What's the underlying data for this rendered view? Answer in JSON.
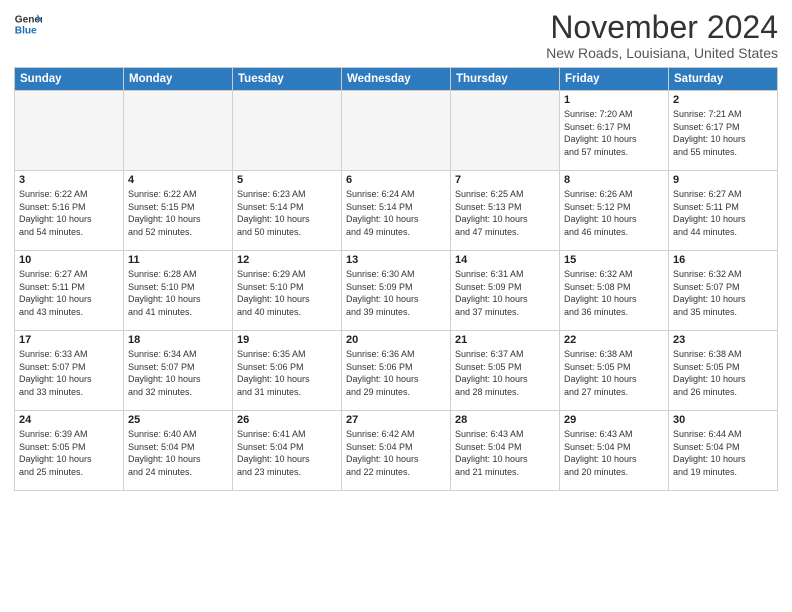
{
  "header": {
    "logo_general": "General",
    "logo_blue": "Blue",
    "month_title": "November 2024",
    "location": "New Roads, Louisiana, United States"
  },
  "weekdays": [
    "Sunday",
    "Monday",
    "Tuesday",
    "Wednesday",
    "Thursday",
    "Friday",
    "Saturday"
  ],
  "weeks": [
    [
      {
        "day": "",
        "info": ""
      },
      {
        "day": "",
        "info": ""
      },
      {
        "day": "",
        "info": ""
      },
      {
        "day": "",
        "info": ""
      },
      {
        "day": "",
        "info": ""
      },
      {
        "day": "1",
        "info": "Sunrise: 7:20 AM\nSunset: 6:17 PM\nDaylight: 10 hours\nand 57 minutes."
      },
      {
        "day": "2",
        "info": "Sunrise: 7:21 AM\nSunset: 6:17 PM\nDaylight: 10 hours\nand 55 minutes."
      }
    ],
    [
      {
        "day": "3",
        "info": "Sunrise: 6:22 AM\nSunset: 5:16 PM\nDaylight: 10 hours\nand 54 minutes."
      },
      {
        "day": "4",
        "info": "Sunrise: 6:22 AM\nSunset: 5:15 PM\nDaylight: 10 hours\nand 52 minutes."
      },
      {
        "day": "5",
        "info": "Sunrise: 6:23 AM\nSunset: 5:14 PM\nDaylight: 10 hours\nand 50 minutes."
      },
      {
        "day": "6",
        "info": "Sunrise: 6:24 AM\nSunset: 5:14 PM\nDaylight: 10 hours\nand 49 minutes."
      },
      {
        "day": "7",
        "info": "Sunrise: 6:25 AM\nSunset: 5:13 PM\nDaylight: 10 hours\nand 47 minutes."
      },
      {
        "day": "8",
        "info": "Sunrise: 6:26 AM\nSunset: 5:12 PM\nDaylight: 10 hours\nand 46 minutes."
      },
      {
        "day": "9",
        "info": "Sunrise: 6:27 AM\nSunset: 5:11 PM\nDaylight: 10 hours\nand 44 minutes."
      }
    ],
    [
      {
        "day": "10",
        "info": "Sunrise: 6:27 AM\nSunset: 5:11 PM\nDaylight: 10 hours\nand 43 minutes."
      },
      {
        "day": "11",
        "info": "Sunrise: 6:28 AM\nSunset: 5:10 PM\nDaylight: 10 hours\nand 41 minutes."
      },
      {
        "day": "12",
        "info": "Sunrise: 6:29 AM\nSunset: 5:10 PM\nDaylight: 10 hours\nand 40 minutes."
      },
      {
        "day": "13",
        "info": "Sunrise: 6:30 AM\nSunset: 5:09 PM\nDaylight: 10 hours\nand 39 minutes."
      },
      {
        "day": "14",
        "info": "Sunrise: 6:31 AM\nSunset: 5:09 PM\nDaylight: 10 hours\nand 37 minutes."
      },
      {
        "day": "15",
        "info": "Sunrise: 6:32 AM\nSunset: 5:08 PM\nDaylight: 10 hours\nand 36 minutes."
      },
      {
        "day": "16",
        "info": "Sunrise: 6:32 AM\nSunset: 5:07 PM\nDaylight: 10 hours\nand 35 minutes."
      }
    ],
    [
      {
        "day": "17",
        "info": "Sunrise: 6:33 AM\nSunset: 5:07 PM\nDaylight: 10 hours\nand 33 minutes."
      },
      {
        "day": "18",
        "info": "Sunrise: 6:34 AM\nSunset: 5:07 PM\nDaylight: 10 hours\nand 32 minutes."
      },
      {
        "day": "19",
        "info": "Sunrise: 6:35 AM\nSunset: 5:06 PM\nDaylight: 10 hours\nand 31 minutes."
      },
      {
        "day": "20",
        "info": "Sunrise: 6:36 AM\nSunset: 5:06 PM\nDaylight: 10 hours\nand 29 minutes."
      },
      {
        "day": "21",
        "info": "Sunrise: 6:37 AM\nSunset: 5:05 PM\nDaylight: 10 hours\nand 28 minutes."
      },
      {
        "day": "22",
        "info": "Sunrise: 6:38 AM\nSunset: 5:05 PM\nDaylight: 10 hours\nand 27 minutes."
      },
      {
        "day": "23",
        "info": "Sunrise: 6:38 AM\nSunset: 5:05 PM\nDaylight: 10 hours\nand 26 minutes."
      }
    ],
    [
      {
        "day": "24",
        "info": "Sunrise: 6:39 AM\nSunset: 5:05 PM\nDaylight: 10 hours\nand 25 minutes."
      },
      {
        "day": "25",
        "info": "Sunrise: 6:40 AM\nSunset: 5:04 PM\nDaylight: 10 hours\nand 24 minutes."
      },
      {
        "day": "26",
        "info": "Sunrise: 6:41 AM\nSunset: 5:04 PM\nDaylight: 10 hours\nand 23 minutes."
      },
      {
        "day": "27",
        "info": "Sunrise: 6:42 AM\nSunset: 5:04 PM\nDaylight: 10 hours\nand 22 minutes."
      },
      {
        "day": "28",
        "info": "Sunrise: 6:43 AM\nSunset: 5:04 PM\nDaylight: 10 hours\nand 21 minutes."
      },
      {
        "day": "29",
        "info": "Sunrise: 6:43 AM\nSunset: 5:04 PM\nDaylight: 10 hours\nand 20 minutes."
      },
      {
        "day": "30",
        "info": "Sunrise: 6:44 AM\nSunset: 5:04 PM\nDaylight: 10 hours\nand 19 minutes."
      }
    ]
  ]
}
